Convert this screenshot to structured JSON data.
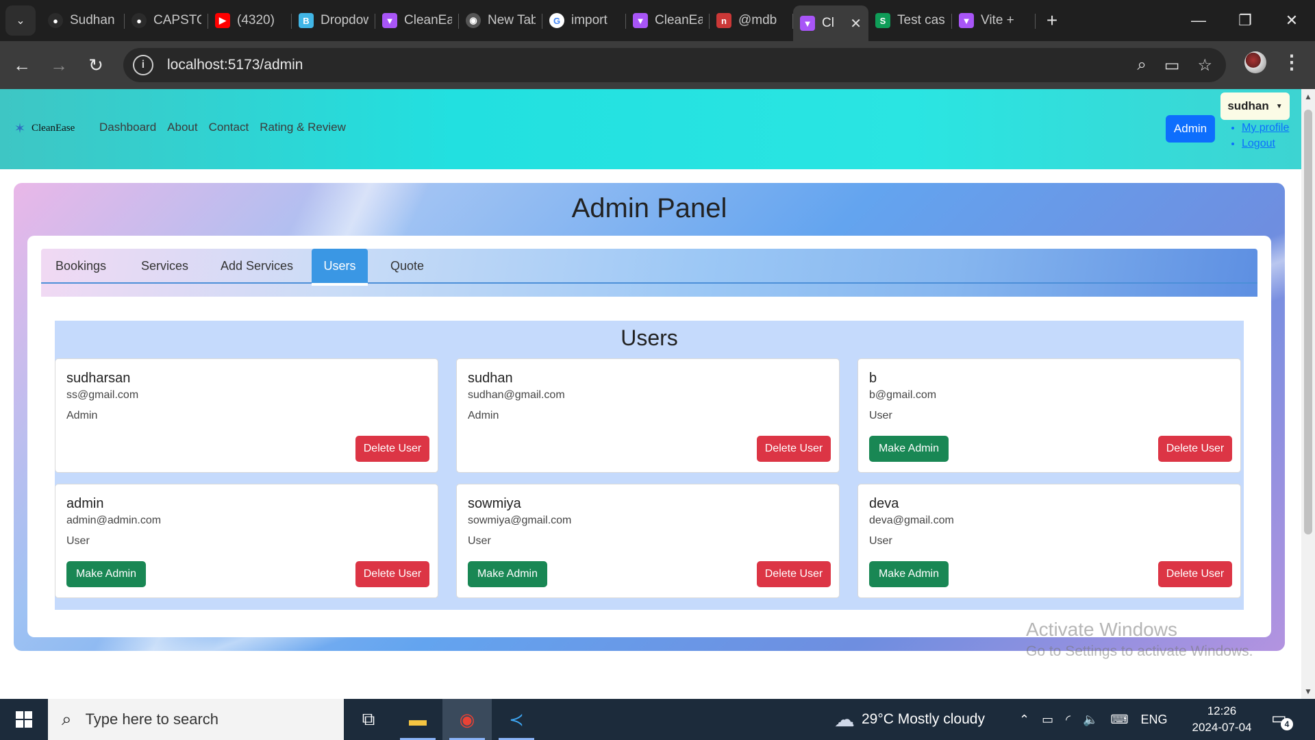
{
  "browser": {
    "tabs": [
      {
        "title": "Sudhan",
        "icon": "github-icon",
        "color": "#2b2b2b"
      },
      {
        "title": "CAPSTONE",
        "icon": "github-icon",
        "color": "#2b2b2b"
      },
      {
        "title": "(4320)",
        "icon": "youtube-icon",
        "color": "#ff0000"
      },
      {
        "title": "Dropdown",
        "icon": "react-bootstrap-icon",
        "color": "#41b6e6"
      },
      {
        "title": "CleanEase",
        "icon": "vite-icon",
        "color": "#a855f7"
      },
      {
        "title": "New Tab",
        "icon": "chrome-icon",
        "color": "#555555"
      },
      {
        "title": "import",
        "icon": "google-icon",
        "color": "#ffffff"
      },
      {
        "title": "CleanEase",
        "icon": "vite-icon",
        "color": "#a855f7"
      },
      {
        "title": "@mdb",
        "icon": "npm-icon",
        "color": "#cb3837"
      },
      {
        "title": "Cl",
        "icon": "vite-icon",
        "color": "#a855f7",
        "active": true
      },
      {
        "title": "Test case",
        "icon": "sheets-icon",
        "color": "#0f9d58"
      },
      {
        "title": "Vite +",
        "icon": "vite-icon",
        "color": "#a855f7"
      }
    ],
    "url": "localhost:5173/admin"
  },
  "navbar": {
    "brand": "CleanEase",
    "links": [
      "Dashboard",
      "About",
      "Contact",
      "Rating & Review"
    ],
    "admin_button": "Admin",
    "user_name": "sudhan",
    "dropdown": [
      "My profile",
      "Logout"
    ]
  },
  "panel": {
    "title": "Admin Panel",
    "tabs": [
      "Bookings",
      "Services",
      "Add Services",
      "Users",
      "Quote"
    ],
    "active_tab": "Users",
    "section_heading": "Users",
    "users": [
      {
        "name": "sudharsan",
        "email": "ss@gmail.com",
        "role": "Admin"
      },
      {
        "name": "sudhan",
        "email": "sudhan@gmail.com",
        "role": "Admin"
      },
      {
        "name": "b",
        "email": "b@gmail.com",
        "role": "User"
      },
      {
        "name": "admin",
        "email": "admin@admin.com",
        "role": "User"
      },
      {
        "name": "sowmiya",
        "email": "sowmiya@gmail.com",
        "role": "User"
      },
      {
        "name": "deva",
        "email": "deva@gmail.com",
        "role": "User"
      }
    ],
    "make_admin_label": "Make Admin",
    "delete_label": "Delete User"
  },
  "watermark": {
    "line1": "Activate Windows",
    "line2": "Go to Settings to activate Windows."
  },
  "taskbar": {
    "search_placeholder": "Type here to search",
    "weather": "29°C  Mostly cloudy",
    "language": "ENG",
    "time": "12:26",
    "date": "2024-07-04",
    "notifications": "4"
  },
  "colors": {
    "navbar": "#22e0e0",
    "primary": "#0d6efd",
    "success": "#198754",
    "danger": "#dc3545",
    "active_tab": "#3a97e4"
  }
}
